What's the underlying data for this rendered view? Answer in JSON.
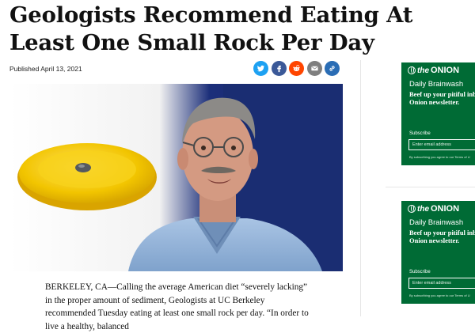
{
  "article": {
    "headline": "Geologists Recommend Eating At Least One Small Rock Per Day",
    "published": "Published April 13, 2021",
    "body": "BERKELEY, CA—Calling the average American diet “severely lacking” in the proper amount of sediment, Geologists at UC Berkeley recommended Tuesday eating at least one small rock per day. “In order to live a healthy, balanced"
  },
  "share": [
    {
      "name": "twitter-icon",
      "color": "#1da1f2"
    },
    {
      "name": "facebook-icon",
      "color": "#3b5998"
    },
    {
      "name": "reddit-icon",
      "color": "#ff4500"
    },
    {
      "name": "email-icon",
      "color": "#7f7f7f"
    },
    {
      "name": "link-icon",
      "color": "#2a6db5"
    }
  ],
  "colors": {
    "newsletter_bg": "#006b35"
  },
  "newsletters": [
    {
      "logo_the": "the",
      "logo_onion": "ONION",
      "title": "Daily Brainwash",
      "desc_line1": "Beef up your pitiful inb",
      "desc_line2": "Onion newsletter.",
      "subscribe_label": "Subscribe",
      "email_placeholder": "Enter email address",
      "fine_print": "By subscribing you agree to our Terms of U"
    },
    {
      "logo_the": "the",
      "logo_onion": "ONION",
      "title": "Daily Brainwash",
      "desc_line1": "Beef up your pitiful inb",
      "desc_line2": "Onion newsletter.",
      "subscribe_label": "Subscribe",
      "email_placeholder": "Enter email address",
      "fine_print": "By subscribing you agree to our Terms of U"
    }
  ]
}
